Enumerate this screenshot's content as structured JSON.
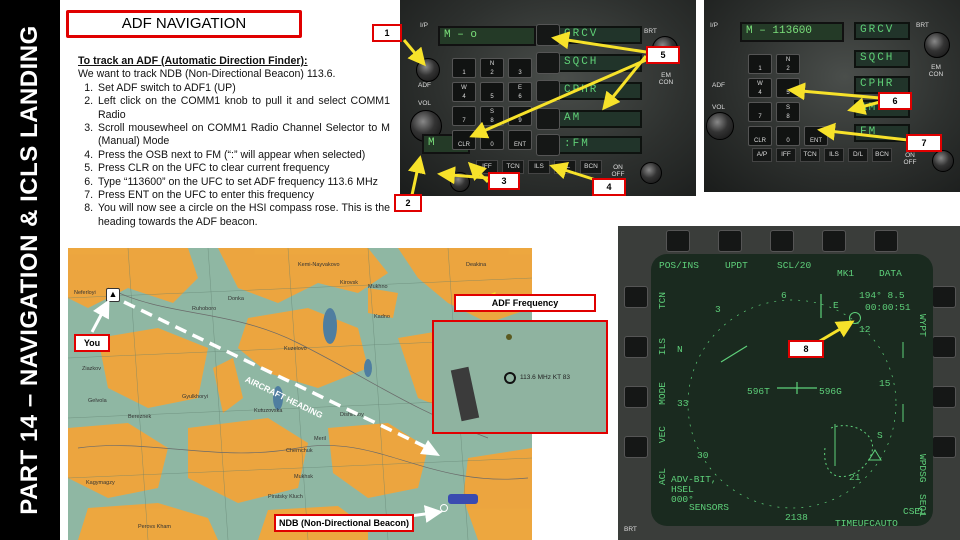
{
  "sidebar": {
    "title": "PART 14 – NAVIGATION & ICLS LANDING"
  },
  "title": "ADF NAVIGATION",
  "instructions": {
    "heading": "To track an ADF (Automatic Direction Finder):",
    "intro": "We want to track NDB (Non-Directional Beacon) 113.6.",
    "steps": [
      "Set ADF switch to ADF1 (UP)",
      "Left click on the COMM1 knob to pull it and select COMM1 Radio",
      "Scroll mousewheel on COMM1 Radio Channel Selector to M (Manual) Mode",
      "Press the OSB next to FM (“:” will appear when selected)",
      "Press CLR on the UFC to clear current frequency",
      "Type “113600” on the UFC to set ADF frequency 113.6 MHz",
      "Press ENT on the UFC to enter this frequency",
      "You will now see a circle on the HSI compass rose. This is the heading towards the ADF beacon."
    ]
  },
  "ufc_left": {
    "scratchpad": "M –   o",
    "options": [
      "GRCV",
      "SQCH",
      "CPHR",
      "AM",
      ":FM"
    ],
    "keys": [
      {
        "top": "",
        "main": "1"
      },
      {
        "top": "N",
        "main": "2"
      },
      {
        "top": "",
        "main": "3"
      },
      {
        "top": "W",
        "main": "4"
      },
      {
        "top": "",
        "main": "5"
      },
      {
        "top": "E",
        "main": "6"
      },
      {
        "top": "",
        "main": "7"
      },
      {
        "top": "S",
        "main": "8"
      },
      {
        "top": "",
        "main": "9"
      },
      {
        "top": "",
        "main": "CLR"
      },
      {
        "top": "",
        "main": "0"
      },
      {
        "top": "",
        "main": "ENT"
      }
    ],
    "labels": {
      "ipv": "I/P",
      "adf": "ADF",
      "vol": "VOL",
      "brt": "BRT",
      "emcon": "EM CON",
      "on_off": "ON OFF"
    },
    "row_buttons": [
      "IFF",
      "TCN",
      "ILS",
      "D/L",
      "BCN"
    ]
  },
  "ufc_right": {
    "scratchpad": "M – 113600",
    "options": [
      "GRCV",
      "SQCH",
      "CPHR",
      "AM",
      "FM"
    ],
    "labels": {
      "ipv": "I/P",
      "adf": "ADF",
      "vol": "VOL",
      "brt": "BRT",
      "emcon": "EM CON",
      "on_off": "ON OFF"
    },
    "row_buttons": [
      "A/P",
      "IFF",
      "TCN",
      "ILS",
      "D/L",
      "BCN"
    ]
  },
  "callouts": [
    "1",
    "2",
    "3",
    "4",
    "5",
    "6",
    "7",
    "8"
  ],
  "map": {
    "towns": [
      "Kemi-Nayvakovo",
      "Kirovsk",
      "Ruhoboro",
      "Ziazkov",
      "Kuzelovo",
      "Kadno",
      "Gelvola",
      "Gyulkhoryi",
      "Kutuzovska",
      "Bereznek",
      "Dishinkoy",
      "Meril",
      "Chernchuk",
      "Kagymagzy",
      "Mukhsk",
      "Piratsky Kluch",
      "Perovs Kham",
      "Deakina",
      "Neferloyi",
      "Donka",
      "Mukhno"
    ],
    "annotation": "AIRCRAFT HEADING",
    "you_label": "You",
    "ndb_label": "NDB (Non-Directional Beacon)",
    "adf_frequency_label": "ADF Frequency",
    "beacon_readout": "113.6 MHz KT 83"
  },
  "hsi": {
    "top_labels": [
      "POS/INS",
      "UPDT",
      "SCL/20",
      "MK1",
      "DATA"
    ],
    "left_labels": [
      "TCN",
      "ILS",
      "MODE",
      "VEC",
      "ACL"
    ],
    "right_labels": [
      "WYPT",
      "WPDSG",
      "SEQ1"
    ],
    "bottom_labels": [
      "SENSORS",
      "2138",
      "TIMEUFC",
      "AUTO",
      "CSEL"
    ],
    "readout_top_right": [
      "194° 8.5",
      "00:00:51"
    ],
    "compass": [
      "6",
      "E",
      "12",
      "3",
      "N",
      "33",
      "30",
      "S",
      "15",
      "21"
    ],
    "heading_left": "596T",
    "heading_right": "596G",
    "bottom_left": [
      "ADV-BIT,",
      "HSEL",
      "000°"
    ],
    "brt": "BRT"
  }
}
